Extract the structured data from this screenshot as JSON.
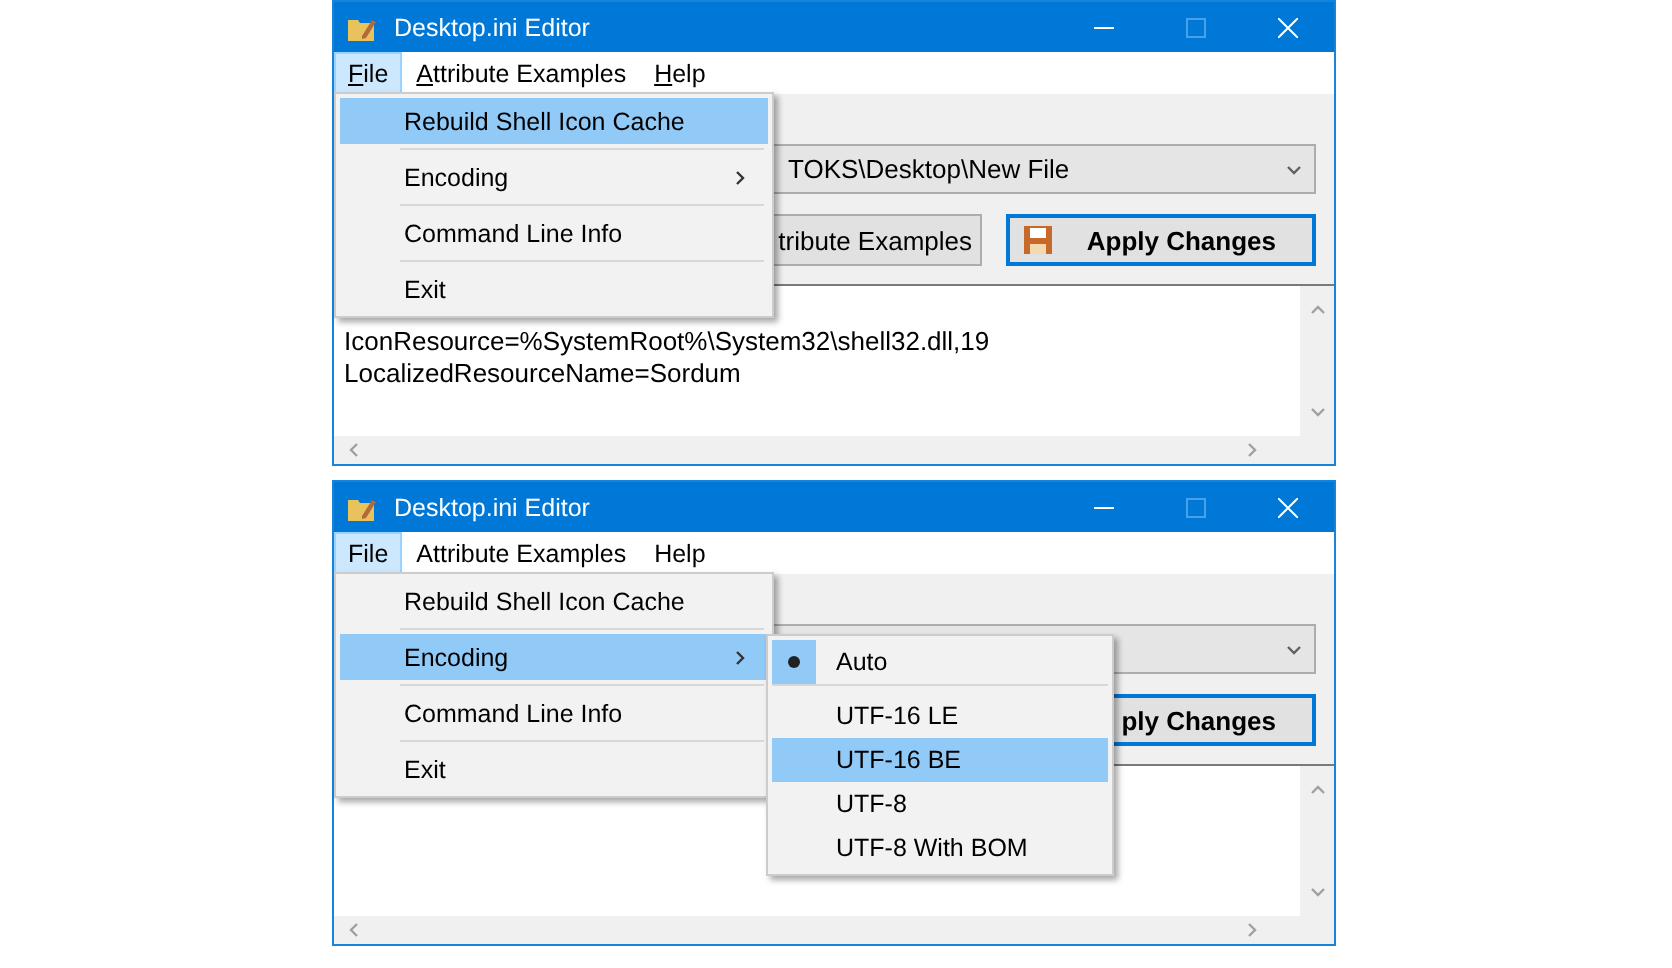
{
  "windows": [
    {
      "title": "Desktop.ini Editor",
      "accelerators_shown": true,
      "menu_bar": [
        {
          "label": "File",
          "selected": true
        },
        {
          "label": "Attribute Examples",
          "selected": false
        },
        {
          "label": "Help",
          "selected": false
        }
      ],
      "path_value": "TOKS\\Desktop\\New File",
      "buttons": [
        {
          "label": "tribute Examples",
          "kind": "plain"
        },
        {
          "label": "Apply Changes",
          "kind": "apply",
          "has_icon": true
        }
      ],
      "editor_lines": [
        "IconResource=%SystemRoot%\\System32\\shell32.dll,19",
        "LocalizedResourceName=Sordum"
      ],
      "menu": [
        {
          "label": "Rebuild Shell Icon Cache",
          "selected": true,
          "has_submenu": false
        },
        {
          "label": "Encoding",
          "selected": false,
          "has_submenu": true
        },
        {
          "label": "Command Line Info",
          "selected": false,
          "has_submenu": false
        },
        {
          "label": "Exit",
          "selected": false,
          "has_submenu": false
        }
      ]
    },
    {
      "title": "Desktop.ini Editor",
      "accelerators_shown": false,
      "menu_bar": [
        {
          "label": "File",
          "selected": true
        },
        {
          "label": "Attribute Examples",
          "selected": false
        },
        {
          "label": "Help",
          "selected": false
        }
      ],
      "buttons": [
        {
          "label": "ply Changes",
          "kind": "apply"
        }
      ],
      "menu": [
        {
          "label": "Rebuild Shell Icon Cache",
          "selected": false,
          "has_submenu": false
        },
        {
          "label": "Encoding",
          "selected": true,
          "has_submenu": true
        },
        {
          "label": "Command Line Info",
          "selected": false,
          "has_submenu": false
        },
        {
          "label": "Exit",
          "selected": false,
          "has_submenu": false
        }
      ],
      "submenu": [
        {
          "label": "Auto",
          "checked": true,
          "selected": false,
          "separator_after": true
        },
        {
          "label": "UTF-16 LE",
          "checked": false,
          "selected": false,
          "separator_after": false
        },
        {
          "label": "UTF-16 BE",
          "checked": false,
          "selected": true,
          "separator_after": false
        },
        {
          "label": "UTF-8",
          "checked": false,
          "selected": false,
          "separator_after": false
        },
        {
          "label": "UTF-8 With BOM",
          "checked": false,
          "selected": false,
          "separator_after": false
        }
      ]
    }
  ]
}
